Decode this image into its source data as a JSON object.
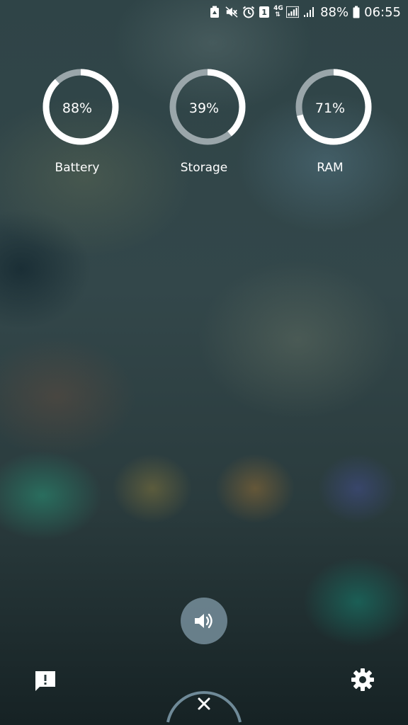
{
  "status_bar": {
    "icons": [
      "battery-saver-icon",
      "mute-icon",
      "alarm-icon",
      "sim-1-icon",
      "network-4g-icon",
      "signal-sim1-icon",
      "signal-sim2-icon",
      "battery-icon"
    ],
    "network_type": "4G",
    "sim_label": "1",
    "battery_percent_text": "88%",
    "time": "06:55"
  },
  "gauges": [
    {
      "label": "Battery",
      "percent_text": "88%",
      "value": 88
    },
    {
      "label": "Storage",
      "percent_text": "39%",
      "value": 39
    },
    {
      "label": "RAM",
      "percent_text": "71%",
      "value": 71
    }
  ],
  "controls": {
    "sound_icon": "volume-icon",
    "feedback_icon": "feedback-icon",
    "settings_icon": "gear-icon",
    "close_icon": "close-icon"
  },
  "colors": {
    "gauge_fill": "#ffffff",
    "gauge_track": "#9aa6aa",
    "sound_button": "#7f9aa8"
  }
}
